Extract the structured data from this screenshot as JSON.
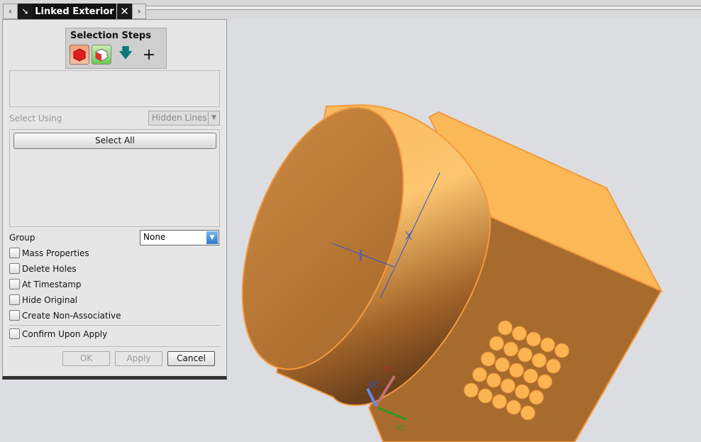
{
  "window": {
    "tab_title": "Linked Exterior",
    "icons": [
      "chevron-left-icon",
      "pin-icon",
      "close-icon",
      "chevron-right-icon"
    ]
  },
  "dialog": {
    "selection_steps": {
      "title": "Selection Steps",
      "steps": [
        "solid-body-icon",
        "faces-icon",
        "arrow-down-icon",
        "plus-icon"
      ]
    },
    "select_using": {
      "label": "Select Using",
      "value": "Hidden Lines"
    },
    "select_all_label": "Select All",
    "group": {
      "label": "Group",
      "value": "None"
    },
    "options": [
      {
        "label": "Mass Properties",
        "checked": false
      },
      {
        "label": "Delete Holes",
        "checked": false
      },
      {
        "label": "At Timestamp",
        "checked": false
      },
      {
        "label": "Hide Original",
        "checked": false
      },
      {
        "label": "Create Non-Associative",
        "checked": false
      }
    ],
    "confirm": {
      "label": "Confirm Upon Apply",
      "checked": false
    },
    "buttons": {
      "ok": "OK",
      "apply": "Apply",
      "cancel": "Cancel"
    }
  },
  "viewport": {
    "body_color": "#f7b04f",
    "axes": {
      "x": "XC",
      "y": "YC",
      "z": "ZC"
    },
    "axis_colors": {
      "x": "#c03030",
      "y": "#2a9a2a",
      "z": "#3050e0"
    }
  }
}
